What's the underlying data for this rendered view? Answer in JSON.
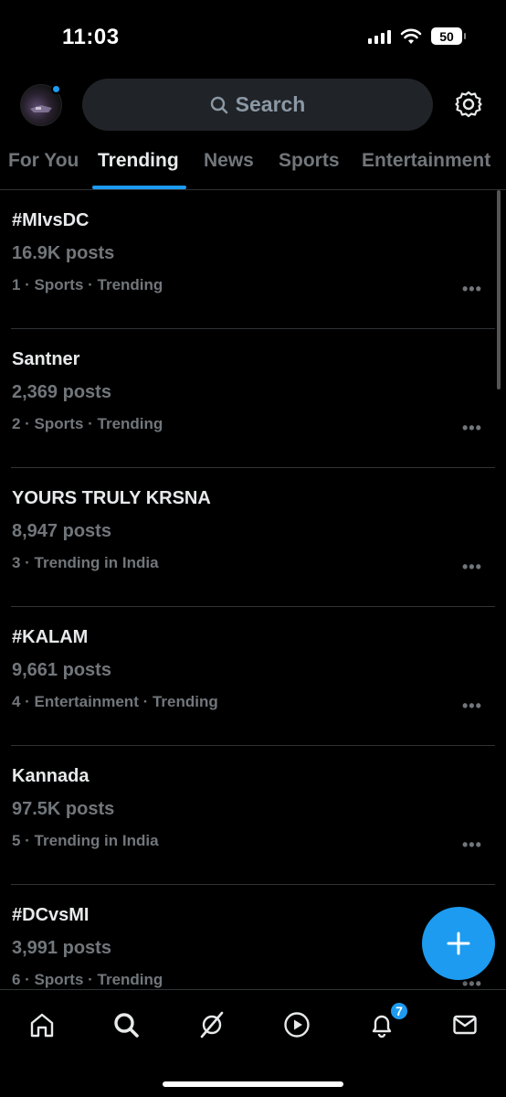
{
  "status_bar": {
    "time": "11:03",
    "battery": "50"
  },
  "header": {
    "search_placeholder": "Search"
  },
  "tabs": [
    {
      "label": "For You",
      "active": false
    },
    {
      "label": "Trending",
      "active": true
    },
    {
      "label": "News",
      "active": false
    },
    {
      "label": "Sports",
      "active": false
    },
    {
      "label": "Entertainment",
      "active": false
    }
  ],
  "trends": [
    {
      "name": "#MIvsDC",
      "posts": "16.9K posts",
      "meta": "1 · Sports · Trending"
    },
    {
      "name": "Santner",
      "posts": "2,369 posts",
      "meta": "2 · Sports · Trending"
    },
    {
      "name": "YOURS TRULY KRSNA",
      "posts": "8,947 posts",
      "meta": "3 · Trending in India"
    },
    {
      "name": "#KALAM",
      "posts": "9,661 posts",
      "meta": "4 · Entertainment · Trending"
    },
    {
      "name": "Kannada",
      "posts": "97.5K posts",
      "meta": "5 · Trending in India"
    },
    {
      "name": "#DCvsMI",
      "posts": "3,991 posts",
      "meta": "6 · Sports · Trending"
    }
  ],
  "more_label": "•••",
  "fab_label": "+",
  "bottom_nav": {
    "items": [
      "home-icon",
      "search-icon",
      "grok-icon",
      "video-icon",
      "notifications-icon",
      "messages-icon"
    ],
    "notification_count": "7"
  },
  "colors": {
    "accent": "#1d9bf0",
    "background": "#000000",
    "muted_text": "#71767b"
  }
}
